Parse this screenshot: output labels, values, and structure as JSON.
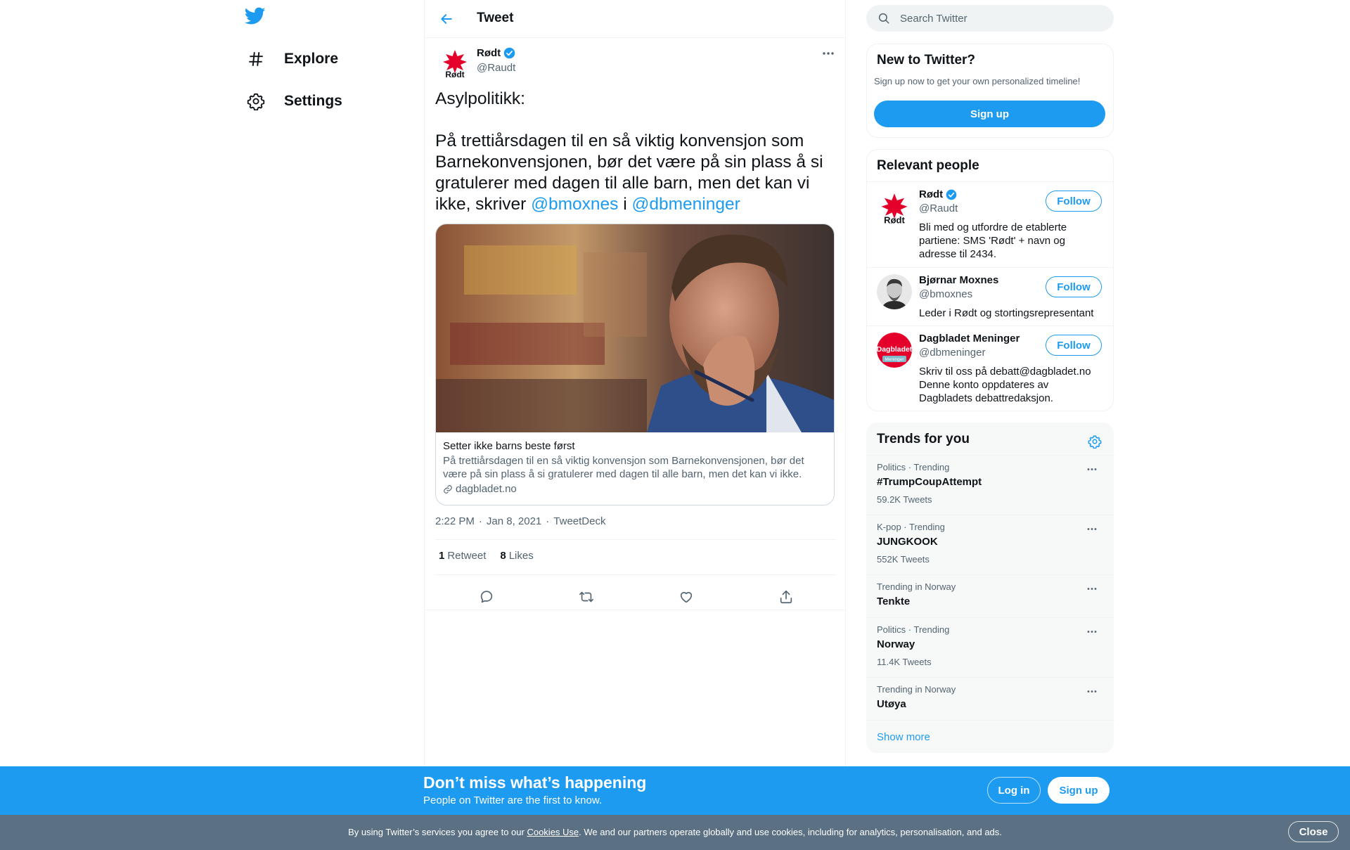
{
  "nav": {
    "explore_label": "Explore",
    "settings_label": "Settings"
  },
  "header": {
    "title": "Tweet"
  },
  "tweet": {
    "author_name": "Rødt",
    "author_handle": "@Raudt",
    "avatar_text": "Rødt",
    "text_intro": "Asylpolitikk:\n\nPå trettiårsdagen til en så viktig konvensjon som Barnekonvensjonen, bør det være på sin plass å si gratulerer med dagen til alle barn, men det kan vi ikke, skriver ",
    "mention1": "@bmoxnes",
    "joiner": " i ",
    "mention2": "@dbmeninger",
    "card": {
      "title": "Setter ikke barns beste først",
      "description": "På trettiårsdagen til en så viktig konvensjon som Barnekonvensjonen, bør det være på sin plass å si gratulerer med dagen til alle barn, men det kan vi ikke.",
      "domain": "dagbladet.no"
    },
    "time": "2:22 PM",
    "dot": "·",
    "date": "Jan 8, 2021",
    "source": "TweetDeck",
    "retweets_count": "1",
    "retweets_label": "Retweet",
    "likes_count": "8",
    "likes_label": "Likes"
  },
  "search": {
    "placeholder": "Search Twitter"
  },
  "new_to_twitter": {
    "title": "New to Twitter?",
    "subtitle": "Sign up now to get your own personalized timeline!",
    "signup_label": "Sign up"
  },
  "relevant_people": {
    "title": "Relevant people",
    "follow_label": "Follow",
    "people": [
      {
        "name": "Rødt",
        "handle": "@Raudt",
        "bio": "Bli med og utfordre de etablerte partiene: SMS 'Rødt' + navn og adresse til 2434.",
        "verified": true,
        "avatar_text": "Rødt"
      },
      {
        "name": "Bjørnar Moxnes",
        "handle": "@bmoxnes",
        "bio": "Leder i Rødt og stortingsrepresentant",
        "verified": false
      },
      {
        "name": "Dagbladet Meninger",
        "handle": "@dbmeninger",
        "bio": "Skriv til oss på debatt@dagbladet.no Denne konto oppdateres av Dagbladets debattredaksjon.",
        "verified": false,
        "avatar_text": "Dagbladet",
        "avatar_subtext": "Meninger"
      }
    ]
  },
  "trends": {
    "title": "Trends for you",
    "items": [
      {
        "context": "Politics · Trending",
        "name": "#TrumpCoupAttempt",
        "count": "59.2K Tweets"
      },
      {
        "context": "K-pop · Trending",
        "name": "JUNGKOOK",
        "count": "552K Tweets"
      },
      {
        "context": "Trending in Norway",
        "name": "Tenkte",
        "count": ""
      },
      {
        "context": "Politics · Trending",
        "name": "Norway",
        "count": "11.4K Tweets"
      },
      {
        "context": "Trending in Norway",
        "name": "Utøya",
        "count": ""
      }
    ],
    "show_more": "Show more"
  },
  "bottom_bar": {
    "title": "Don’t miss what’s happening",
    "subtitle": "People on Twitter are the first to know.",
    "login_label": "Log in",
    "signup_label": "Sign up"
  },
  "cookie_bar": {
    "text_before": "By using Twitter’s services you agree to our ",
    "link": "Cookies Use",
    "text_after": ". We and our partners operate globally and use cookies, including for analytics, personalisation, and ads.",
    "close_label": "Close"
  },
  "colors": {
    "brand": "#1d9bf0",
    "text_primary": "#0f1419",
    "text_secondary": "#536471",
    "rodt_red": "#e4002b",
    "cookie_bar": "#5b7083"
  }
}
